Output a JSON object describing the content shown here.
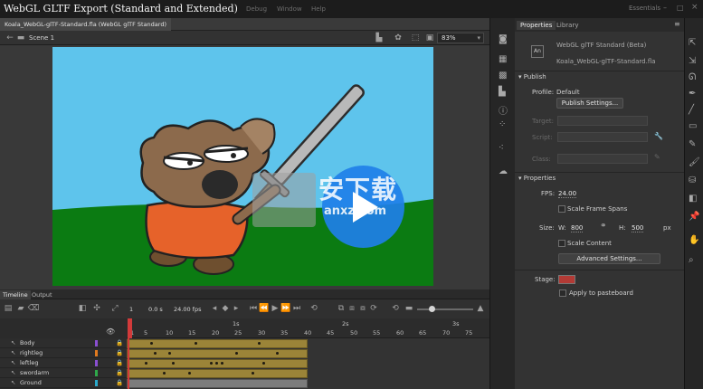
{
  "window": {
    "caption": "WebGL GLTF Export (Standard and Extended)",
    "menu": [
      "Debug",
      "Window",
      "Help"
    ],
    "workspace": "Essentials"
  },
  "document": {
    "tab": "Koala_WebGL-glTF-Standard.fla (WebGL glTF Standard)",
    "scene": "Scene 1",
    "zoom": "83%"
  },
  "timeline": {
    "tabs": [
      "Timeline",
      "Output"
    ],
    "current_frame": "1",
    "time": "0.0 s",
    "fps": "24.00 fps",
    "seconds": [
      "1s",
      "2s",
      "3s"
    ],
    "frame_numbers": [
      "1",
      "5",
      "10",
      "15",
      "20",
      "25",
      "30",
      "35",
      "40",
      "45",
      "50",
      "55",
      "60",
      "65",
      "70",
      "75"
    ],
    "layers": [
      {
        "name": "Body",
        "color": "#8a4fd1"
      },
      {
        "name": "rightleg",
        "color": "#e07a1f"
      },
      {
        "name": "leftleg",
        "color": "#8a4fd1"
      },
      {
        "name": "swordarm",
        "color": "#2fa84a"
      },
      {
        "name": "Ground",
        "color": "#2aa8c9"
      }
    ]
  },
  "properties": {
    "tabs": [
      "Properties",
      "Library"
    ],
    "doc_type": "WebGL glTF Standard (Beta)",
    "file_name": "Koala_WebGL-glTF-Standard.fla",
    "publish": {
      "header": "Publish",
      "profile_label": "Profile:",
      "profile_value": "Default",
      "settings_button": "Publish Settings...",
      "target_label": "Target:",
      "script_label": "Script:",
      "class_label": "Class:"
    },
    "props": {
      "header": "Properties",
      "fps_label": "FPS:",
      "fps_value": "24.00",
      "scale_spans": "Scale Frame Spans",
      "size_label": "Size:",
      "w_label": "W:",
      "w_value": "800",
      "h_label": "H:",
      "h_value": "500",
      "unit": "px",
      "scale_content": "Scale Content",
      "advanced_button": "Advanced Settings...",
      "stage_label": "Stage:",
      "stage_color": "#b23a35",
      "pasteboard": "Apply to pasteboard"
    }
  },
  "watermark": {
    "text": "安下载",
    "sub": "anxz.com"
  },
  "colors": {
    "sky": "#5ec4ec",
    "grass": "#0b7b12",
    "accent_blue": "#1f7fe8"
  }
}
